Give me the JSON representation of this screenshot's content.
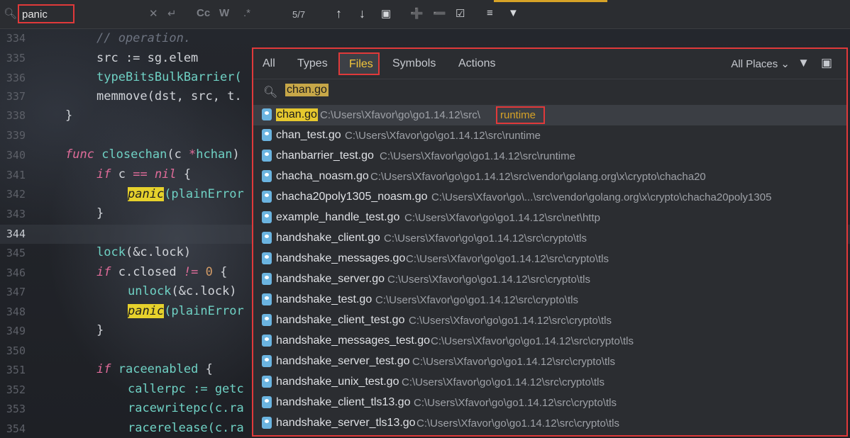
{
  "findbar": {
    "query": "panic",
    "match_count": "5/7",
    "buttons": [
      "Cc",
      "W",
      ".*"
    ]
  },
  "editor": {
    "lines": [
      {
        "num": "334",
        "text": "// operation."
      },
      {
        "num": "335",
        "text": "src := sg.elem"
      },
      {
        "num": "336",
        "text": "typeBitsBulkBarrier("
      },
      {
        "num": "337",
        "text": "memmove(dst, src, t."
      },
      {
        "num": "338",
        "text": "}"
      },
      {
        "num": "339",
        "text": ""
      },
      {
        "num": "340",
        "text": "func closechan(c *hchan)"
      },
      {
        "num": "341",
        "text": "if c == nil {"
      },
      {
        "num": "342",
        "text": "panic(plainError"
      },
      {
        "num": "343",
        "text": "}"
      },
      {
        "num": "344",
        "text": ""
      },
      {
        "num": "345",
        "text": "lock(&c.lock)"
      },
      {
        "num": "346",
        "text": "if c.closed != 0 {"
      },
      {
        "num": "347",
        "text": "unlock(&c.lock)"
      },
      {
        "num": "348",
        "text": "panic(plainError"
      },
      {
        "num": "349",
        "text": "}"
      },
      {
        "num": "350",
        "text": ""
      },
      {
        "num": "351",
        "text": "if raceenabled {"
      },
      {
        "num": "352",
        "text": "callerpc := getc"
      },
      {
        "num": "353",
        "text": "racewritepc(c.ra"
      },
      {
        "num": "354",
        "text": "racerelease(c.ra"
      }
    ]
  },
  "popup": {
    "tabs": [
      "All",
      "Types",
      "Files",
      "Symbols",
      "Actions"
    ],
    "active_tab": "Files",
    "places": "All Places",
    "search_value": "chan.go",
    "results": [
      {
        "name": "chan.go",
        "path": "C:\\Users\\Xfavor\\go\\go1.14.12\\src\\",
        "suffix": "runtime"
      },
      {
        "name": "chan_test.go",
        "path": "C:\\Users\\Xfavor\\go\\go1.14.12\\src\\runtime"
      },
      {
        "name": "chanbarrier_test.go",
        "path": "C:\\Users\\Xfavor\\go\\go1.14.12\\src\\runtime"
      },
      {
        "name": "chacha_noasm.go",
        "path": "C:\\Users\\Xfavor\\go\\go1.14.12\\src\\vendor\\golang.org\\x\\crypto\\chacha20"
      },
      {
        "name": "chacha20poly1305_noasm.go",
        "path": "C:\\Users\\Xfavor\\go\\...\\src\\vendor\\golang.org\\x\\crypto\\chacha20poly1305"
      },
      {
        "name": "example_handle_test.go",
        "path": "C:\\Users\\Xfavor\\go\\go1.14.12\\src\\net\\http"
      },
      {
        "name": "handshake_client.go",
        "path": "C:\\Users\\Xfavor\\go\\go1.14.12\\src\\crypto\\tls"
      },
      {
        "name": "handshake_messages.go",
        "path": "C:\\Users\\Xfavor\\go\\go1.14.12\\src\\crypto\\tls"
      },
      {
        "name": "handshake_server.go",
        "path": "C:\\Users\\Xfavor\\go\\go1.14.12\\src\\crypto\\tls"
      },
      {
        "name": "handshake_test.go",
        "path": "C:\\Users\\Xfavor\\go\\go1.14.12\\src\\crypto\\tls"
      },
      {
        "name": "handshake_client_test.go",
        "path": "C:\\Users\\Xfavor\\go\\go1.14.12\\src\\crypto\\tls"
      },
      {
        "name": "handshake_messages_test.go",
        "path": "C:\\Users\\Xfavor\\go\\go1.14.12\\src\\crypto\\tls"
      },
      {
        "name": "handshake_server_test.go",
        "path": "C:\\Users\\Xfavor\\go\\go1.14.12\\src\\crypto\\tls"
      },
      {
        "name": "handshake_unix_test.go",
        "path": "C:\\Users\\Xfavor\\go\\go1.14.12\\src\\crypto\\tls"
      },
      {
        "name": "handshake_client_tls13.go",
        "path": "C:\\Users\\Xfavor\\go\\go1.14.12\\src\\crypto\\tls"
      },
      {
        "name": "handshake_server_tls13.go",
        "path": "C:\\Users\\Xfavor\\go\\go1.14.12\\src\\crypto\\tls"
      }
    ]
  }
}
